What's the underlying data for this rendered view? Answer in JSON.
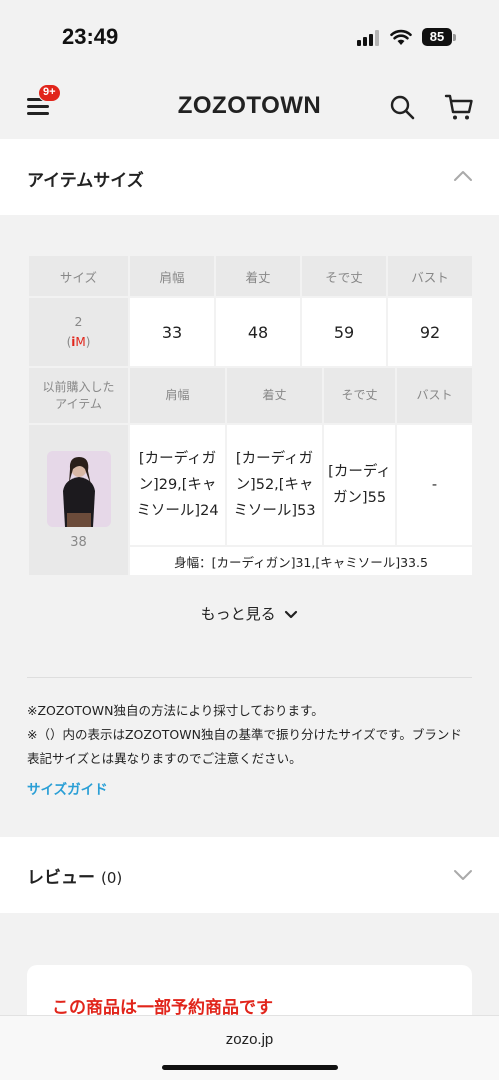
{
  "status_bar": {
    "time": "23:49",
    "battery": "85"
  },
  "header": {
    "logo": "ZOZOTOWN",
    "menu_badge": "9+"
  },
  "item_size": {
    "title": "アイテムサイズ",
    "columns": [
      "サイズ",
      "肩幅",
      "着丈",
      "そで丈",
      "バスト"
    ],
    "size_row": {
      "size": "2",
      "size_sub_i": "i",
      "size_sub_m": "M",
      "values": [
        "33",
        "48",
        "59",
        "92"
      ]
    },
    "previous": {
      "label_line1": "以前購入した",
      "label_line2": "アイテム",
      "columns": [
        "肩幅",
        "着丈",
        "そで丈",
        "バスト"
      ],
      "size": "38",
      "values": [
        "[カーディガン]29,[キャミソール]24",
        "[カーディガン]52,[キャミソール]53",
        "[カーディガン]55",
        "-"
      ],
      "note": "身幅：[カーディガン]31,[キャミソール]33.5"
    },
    "more_label": "もっと見る",
    "notes": [
      "※ZOZOTOWN独自の方法により採寸しております。",
      "※（）内の表示はZOZOTOWN独自の基準で振り分けたサイズです。ブランド表記サイズとは異なりますのでご注意ください。"
    ],
    "size_guide": "サイズガイド"
  },
  "review": {
    "title": "レビュー",
    "count": "(0)"
  },
  "preorder": {
    "text": "この商品は一部予約商品です"
  },
  "browser": {
    "url": "zozo.jp"
  },
  "colors": {
    "accent_red": "#e1251b",
    "link_blue": "#2a9fd6"
  }
}
